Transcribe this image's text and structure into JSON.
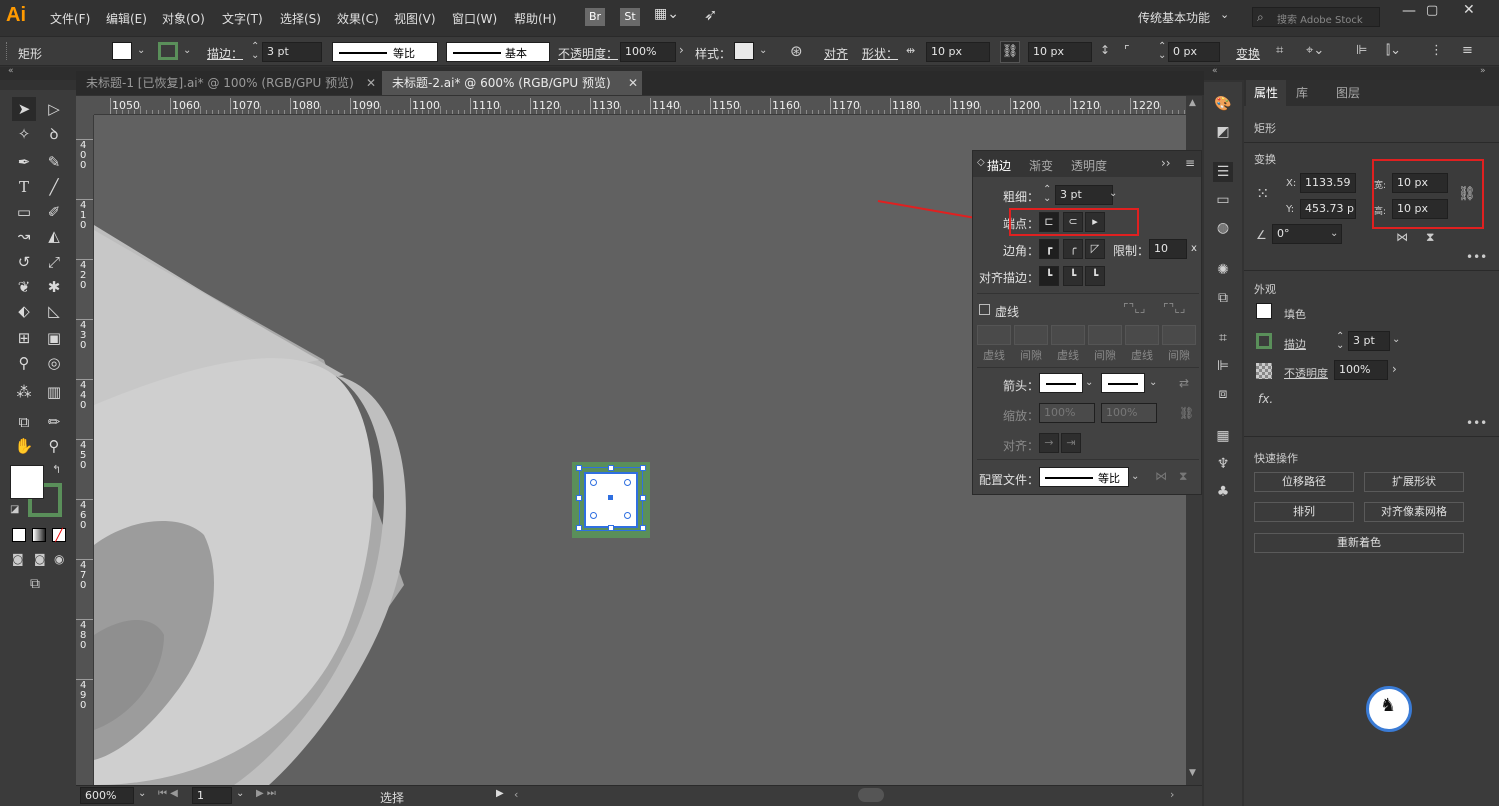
{
  "app": {
    "logo": "Ai"
  },
  "menu": [
    "文件(F)",
    "编辑(E)",
    "对象(O)",
    "文字(T)",
    "选择(S)",
    "效果(C)",
    "视图(V)",
    "窗口(W)",
    "帮助(H)"
  ],
  "menu_right": {
    "br": "Br",
    "st": "St",
    "workspace": "传统基本功能",
    "search_placeholder": "搜索 Adobe Stock"
  },
  "control_bar": {
    "object_type": "矩形",
    "stroke_label": "描边：",
    "stroke_value": "3 pt",
    "profile1": "等比",
    "profile2": "基本",
    "opacity_label": "不透明度：",
    "opacity_value": "100%",
    "style_label": "样式：",
    "align_label": "对齐",
    "shape_label": "形状：",
    "width_value": "10 px",
    "height_value": "10 px",
    "corner_value": "0 px",
    "transform_label": "变换"
  },
  "doc_tabs": [
    {
      "label": "未标题-1  [已恢复].ai* @ 100% (RGB/GPU 预览)",
      "active": false
    },
    {
      "label": "未标题-2.ai* @ 600% (RGB/GPU 预览)",
      "active": true
    }
  ],
  "ruler_h": [
    "1050",
    "1060",
    "1070",
    "1080",
    "1090",
    "1100",
    "1110",
    "1120",
    "1130",
    "1140",
    "1150",
    "1160",
    "1170",
    "1180",
    "1190",
    "1200",
    "1210",
    "1220"
  ],
  "ruler_v": [
    "400",
    "410",
    "420",
    "430",
    "440",
    "450",
    "460",
    "470",
    "480",
    "490"
  ],
  "status": {
    "zoom": "600%",
    "artboard": "1",
    "tool": "选择"
  },
  "stroke_panel": {
    "tabs": [
      "描边",
      "渐变",
      "透明度"
    ],
    "weight_label": "粗细：",
    "weight_value": "3 pt",
    "cap_label": "端点：",
    "corner_label": "边角：",
    "limit_label": "限制：",
    "limit_value": "10",
    "limit_unit": "x",
    "align_label": "对齐描边：",
    "dashed_label": "虚线",
    "dash_headers": [
      "虚线",
      "间隙",
      "虚线",
      "间隙",
      "虚线",
      "间隙"
    ],
    "arrow_label": "箭头：",
    "scale_label": "缩放：",
    "scale1": "100%",
    "scale2": "100%",
    "arrow_align_label": "对齐：",
    "profile_label": "配置文件：",
    "profile_value": "等比"
  },
  "props_panel": {
    "tabs": [
      "属性",
      "库",
      "图层"
    ],
    "object_type": "矩形",
    "transform_title": "变换",
    "x_label": "X:",
    "x_value": "1133.59",
    "y_label": "Y:",
    "y_value": "453.73 p",
    "w_label": "宽:",
    "w_value": "10 px",
    "h_label": "高:",
    "h_value": "10 px",
    "angle_value": "0°",
    "appearance_title": "外观",
    "fill_label": "填色",
    "stroke_label": "描边",
    "stroke_value": "3 pt",
    "opacity_label": "不透明度",
    "opacity_value": "100%",
    "fx_label": "fx.",
    "quick_title": "快速操作",
    "quick_buttons": [
      "位移路径",
      "扩展形状",
      "排列",
      "对齐像素网格",
      "重新着色"
    ]
  },
  "colors": {
    "accent_red": "#e02020",
    "selection_blue": "#2f6fe0",
    "stroke_green": "#5a8f5a",
    "canvas": "#616161"
  }
}
